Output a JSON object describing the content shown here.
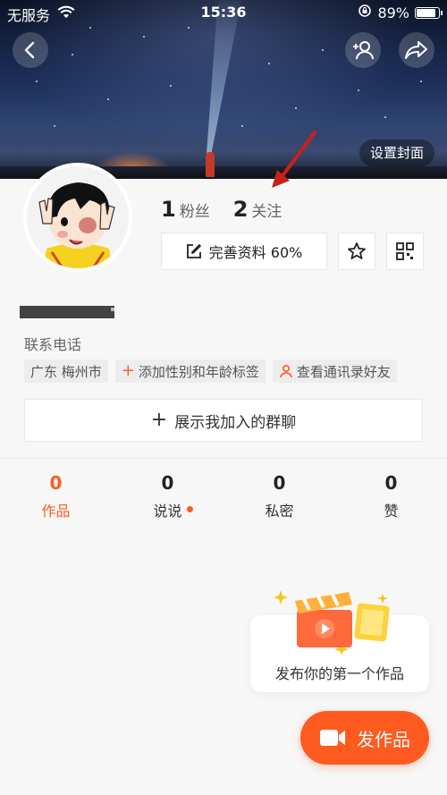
{
  "status_bar": {
    "carrier": "无服务",
    "time": "15:36",
    "battery": "89%"
  },
  "cover": {
    "set_cover_label": "设置封面"
  },
  "profile": {
    "followers_count": "1",
    "followers_label": "粉丝",
    "following_count": "2",
    "following_label": "关注",
    "edit_profile_label": "完善资料 60%",
    "contact_label": "联系电话"
  },
  "tags": [
    {
      "text": "广东 梅州市"
    },
    {
      "text": "添加性别和年龄标签"
    },
    {
      "text": "查看通讯录好友"
    }
  ],
  "group_button": {
    "label": "展示我加入的群聊"
  },
  "tabs": [
    {
      "count": "0",
      "label": "作品",
      "active": true
    },
    {
      "count": "0",
      "label": "说说",
      "dot": true
    },
    {
      "count": "0",
      "label": "私密"
    },
    {
      "count": "0",
      "label": "赞"
    }
  ],
  "publish_card": {
    "text": "发布你的第一个作品"
  },
  "fab": {
    "label": "发作品"
  },
  "colors": {
    "accent": "#ff5a1f"
  },
  "icons": [
    "wifi-icon",
    "lock-rotation-icon",
    "back-icon",
    "add-friend-icon",
    "share-icon",
    "edit-icon",
    "star-icon",
    "qrcode-icon",
    "plus-icon",
    "contacts-icon",
    "camera-icon"
  ]
}
